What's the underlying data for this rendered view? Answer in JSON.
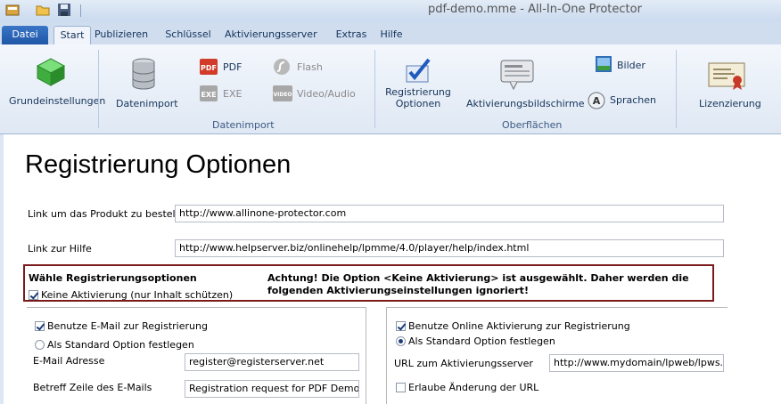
{
  "window": {
    "title": "pdf-demo.mme - All-In-One Protector"
  },
  "tabs": [
    "Datei",
    "Start",
    "Publizieren",
    "Schlüssel",
    "Aktivierungsserver",
    "Extras",
    "Hilfe"
  ],
  "ribbon": {
    "grundeinstellungen": "Grundeinstellungen",
    "datenimport": "Datenimport",
    "pdf": "PDF",
    "exe": "EXE",
    "flash": "Flash",
    "video_audio": "Video/Audio",
    "group_datenimport": "Datenimport",
    "registrierung_optionen": "Registrierung Optionen",
    "aktivierungsbildschirme": "Aktivierungsbildschirme",
    "bilder": "Bilder",
    "sprachen": "Sprachen",
    "group_oberflaechen": "Oberflächen",
    "lizenzierung": "Lizenzierung"
  },
  "page": {
    "title": "Registrierung Optionen",
    "link_produkt_label": "Link um das Produkt zu bestellen",
    "link_produkt_value": "http://www.allinone-protector.com",
    "link_hilfe_label": "Link zur Hilfe",
    "link_hilfe_value": "http://www.helpserver.biz/onlinehelp/lpmme/4.0/player/help/index.html",
    "reg_options_heading": "Wähle Registrierungsoptionen",
    "keine_aktivierung_label": "Keine Aktivierung (nur Inhalt schützen)",
    "keine_aktivierung_checked": true,
    "warning_text": "Achtung! Die Option <Keine Aktivierung> ist ausgewählt. Daher werden die folgenden Aktivierungseinstellungen ignoriert!",
    "email": {
      "use_label": "Benutze E-Mail zur Registrierung",
      "use_checked": true,
      "default_label": "Als Standard Option festlegen",
      "default_selected": false,
      "address_label": "E-Mail Adresse",
      "address_value": "register@registerserver.net",
      "subject_label": "Betreff Zeile des E-Mails",
      "subject_value": "Registration request for PDF  Demo"
    },
    "online": {
      "use_label": "Benutze Online Aktivierung zur Registrierung",
      "use_checked": true,
      "default_label": "Als Standard Option festlegen",
      "default_selected": true,
      "url_label": "URL zum Aktivierungsserver",
      "url_value": "http://www.mydomain/lpweb/lpws.asmx",
      "allow_change_label": "Erlaube Änderung der URL",
      "allow_change_checked": false
    }
  },
  "colors": {
    "ribbon_bg": "#dfe8f4",
    "file_tab": "#2a62b5",
    "warning_border": "#7a1a1a"
  }
}
